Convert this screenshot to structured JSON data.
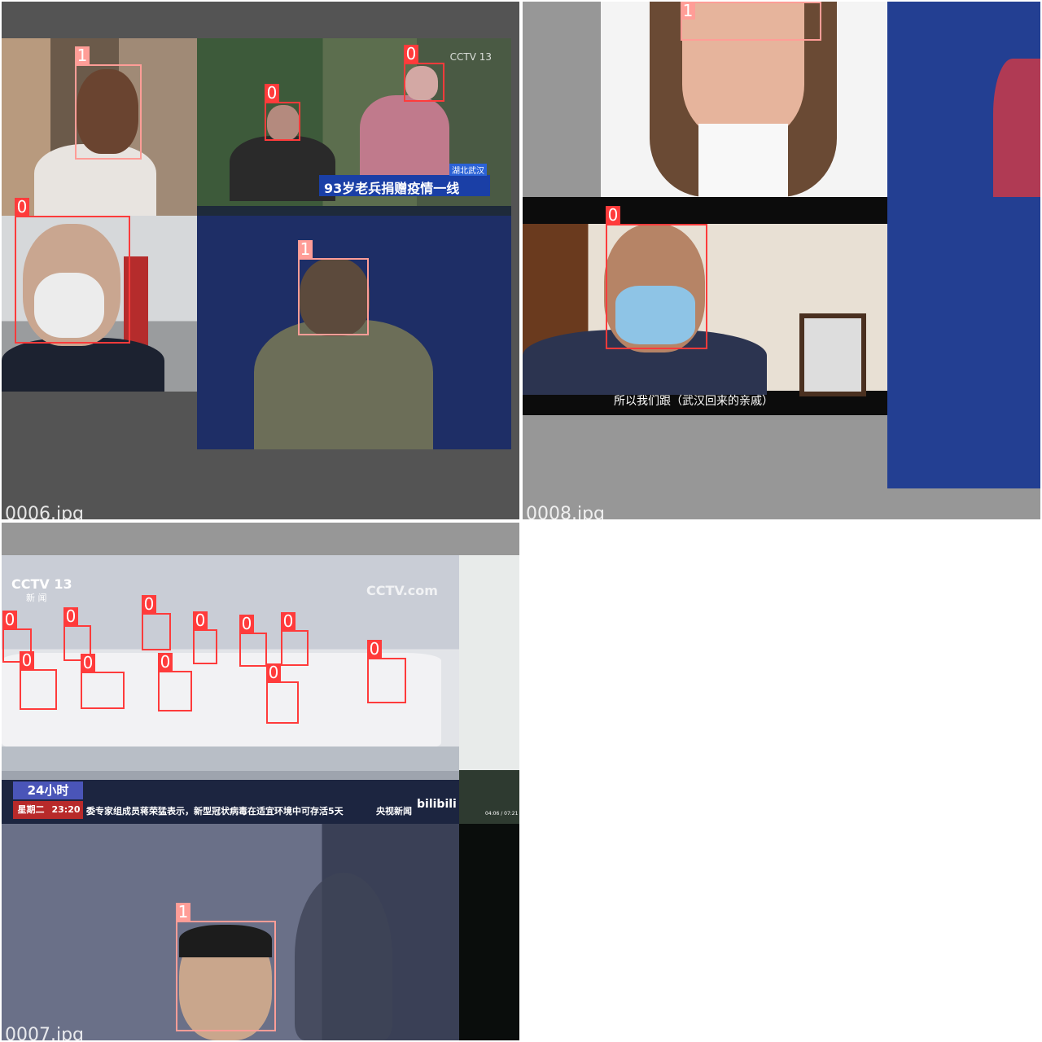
{
  "tiles": [
    {
      "filename": "0006.jpg"
    },
    {
      "filename": "0008.jpg"
    },
    {
      "filename": "0007.jpg"
    }
  ],
  "colors": {
    "class_0": "#ff3b3b",
    "class_1": "#ff9d97",
    "tile_bg_dark": "#545454",
    "tile_bg_light": "#979797"
  },
  "detections": {
    "t6": [
      {
        "label": "1",
        "class": 1
      },
      {
        "label": "0",
        "class": 0
      },
      {
        "label": "0",
        "class": 0
      },
      {
        "label": "0",
        "class": 0
      },
      {
        "label": "1",
        "class": 1
      }
    ],
    "t8": [
      {
        "label": "1",
        "class": 1
      },
      {
        "label": "0",
        "class": 0
      }
    ],
    "t7": [
      {
        "label": "0",
        "class": 0
      },
      {
        "label": "0",
        "class": 0
      },
      {
        "label": "0",
        "class": 0
      },
      {
        "label": "0",
        "class": 0
      },
      {
        "label": "0",
        "class": 0
      },
      {
        "label": "0",
        "class": 0
      },
      {
        "label": "0",
        "class": 0
      },
      {
        "label": "0",
        "class": 0
      },
      {
        "label": "0",
        "class": 0
      },
      {
        "label": "0",
        "class": 0
      },
      {
        "label": "0",
        "class": 0
      },
      {
        "label": "1",
        "class": 1
      }
    ]
  },
  "overlay_text": {
    "cctv_logo": "CCTV 13",
    "cctv_sub": "新 闻",
    "cctv_com": "CCTV.com",
    "news_banner": "93岁老兵捐赠疫情一线",
    "news_place": "湖北武汉",
    "subtitle_0008": "所以我们跟（武汉回来的亲戚）",
    "badge_24": "24小时",
    "day_0007": "星期二",
    "time_0007": "23:20",
    "ticker_0007": "委专家组成员蒋荣猛表示，新型冠状病毒在适宜环境中可存活5天",
    "channel_0007": "央视新闻",
    "bili": "bilibili",
    "player_time": "04:06 / 07:21"
  }
}
